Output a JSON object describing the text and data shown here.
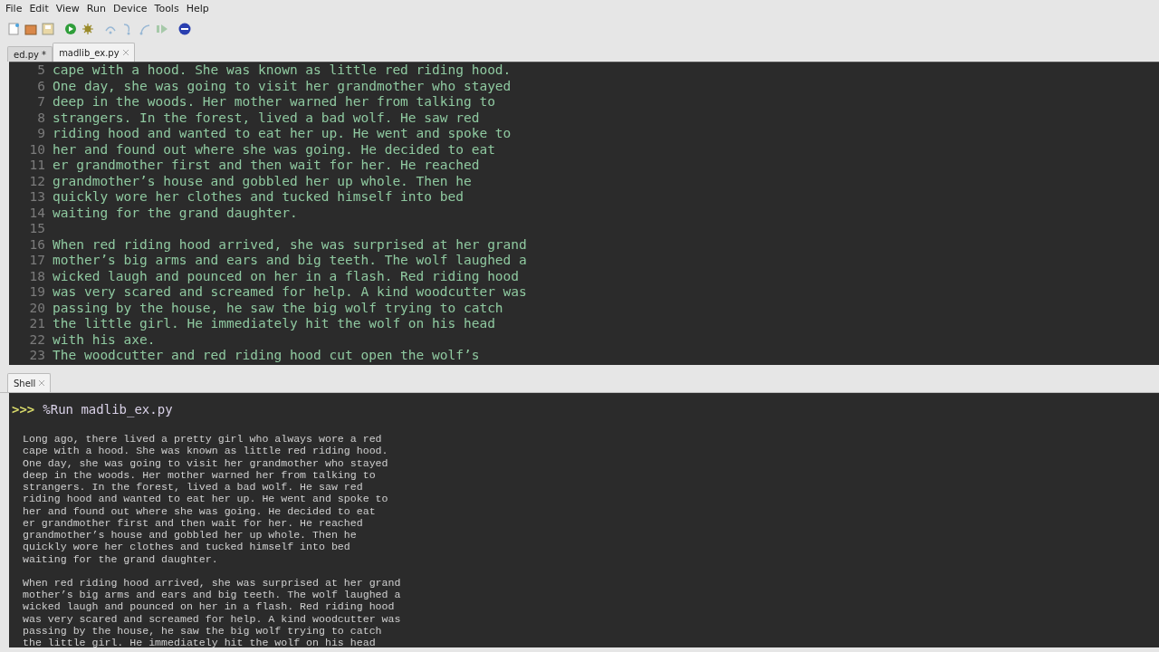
{
  "menu": [
    "File",
    "Edit",
    "View",
    "Run",
    "Device",
    "Tools",
    "Help"
  ],
  "toolbar": [
    {
      "kind": "new"
    },
    {
      "kind": "open"
    },
    {
      "kind": "save"
    },
    {
      "kind": "run"
    },
    {
      "kind": "debug"
    },
    {
      "kind": "step-over",
      "disabled": true
    },
    {
      "kind": "step-into",
      "disabled": true
    },
    {
      "kind": "step-out",
      "disabled": true
    },
    {
      "kind": "resume",
      "disabled": true
    },
    {
      "kind": "stop"
    }
  ],
  "editor_tabs": [
    {
      "label": "ed.py *",
      "selected": false
    },
    {
      "label": "madlib_ex.py",
      "selected": true
    }
  ],
  "editor": {
    "lines": [
      {
        "number": "5",
        "text": "cape with a hood. She was known as little red riding hood."
      },
      {
        "number": "6",
        "text": "One day, she was going to visit her grandmother who stayed"
      },
      {
        "number": "7",
        "text": "deep in the woods. Her mother warned her from talking to"
      },
      {
        "number": "8",
        "text": "strangers. In the forest, lived a bad wolf. He saw red"
      },
      {
        "number": "9",
        "text": "riding hood and wanted to eat her up. He went and spoke to"
      },
      {
        "number": "10",
        "text": "her and found out where she was going. He decided to eat"
      },
      {
        "number": "11",
        "text": "er grandmother first and then wait for her. He reached"
      },
      {
        "number": "12",
        "text": "grandmother’s house and gobbled her up whole. Then he"
      },
      {
        "number": "13",
        "text": "quickly wore her clothes and tucked himself into bed"
      },
      {
        "number": "14",
        "text": "waiting for the grand daughter."
      },
      {
        "number": "15"
      },
      {
        "number": "16",
        "text": "When red riding hood arrived, she was surprised at her grand"
      },
      {
        "number": "17",
        "text": "mother’s big arms and ears and big teeth. The wolf laughed a"
      },
      {
        "number": "18",
        "text": "wicked laugh and pounced on her in a flash. Red riding hood"
      },
      {
        "number": "19",
        "text": "was very scared and screamed for help. A kind woodcutter was"
      },
      {
        "number": "20",
        "text": "passing by the house, he saw the big wolf trying to catch"
      },
      {
        "number": "21",
        "text": "the little girl. He immediately hit the wolf on his head"
      },
      {
        "number": "22",
        "text": "with his axe."
      },
      {
        "number": "23",
        "text": "The woodcutter and red riding hood cut open the wolf’s"
      }
    ]
  },
  "shell": {
    "tab": {
      "label": "Shell",
      "selected": true
    },
    "prompt": ">>>",
    "command": "%Run madlib_ex.py",
    "output": [
      [
        "Long ago, there lived a pretty girl who always wore a red",
        "cape with a hood. She was known as little red riding hood.",
        "One day, she was going to visit her grandmother who stayed",
        "deep in the woods. Her mother warned her from talking to",
        "strangers. In the forest, lived a bad wolf. He saw red",
        "riding hood and wanted to eat her up. He went and spoke to",
        "her and found out where she was going. He decided to eat",
        "er grandmother first and then wait for her. He reached",
        "grandmother’s house and gobbled her up whole. Then he",
        "quickly wore her clothes and tucked himself into bed",
        "waiting for the grand daughter."
      ],
      [
        "When red riding hood arrived, she was surprised at her grand",
        "mother’s big arms and ears and big teeth. The wolf laughed a",
        "wicked laugh and pounced on her in a flash. Red riding hood",
        "was very scared and screamed for help. A kind woodcutter was",
        "passing by the house, he saw the big wolf trying to catch",
        "the little girl. He immediately hit the wolf on his head"
      ]
    ]
  }
}
